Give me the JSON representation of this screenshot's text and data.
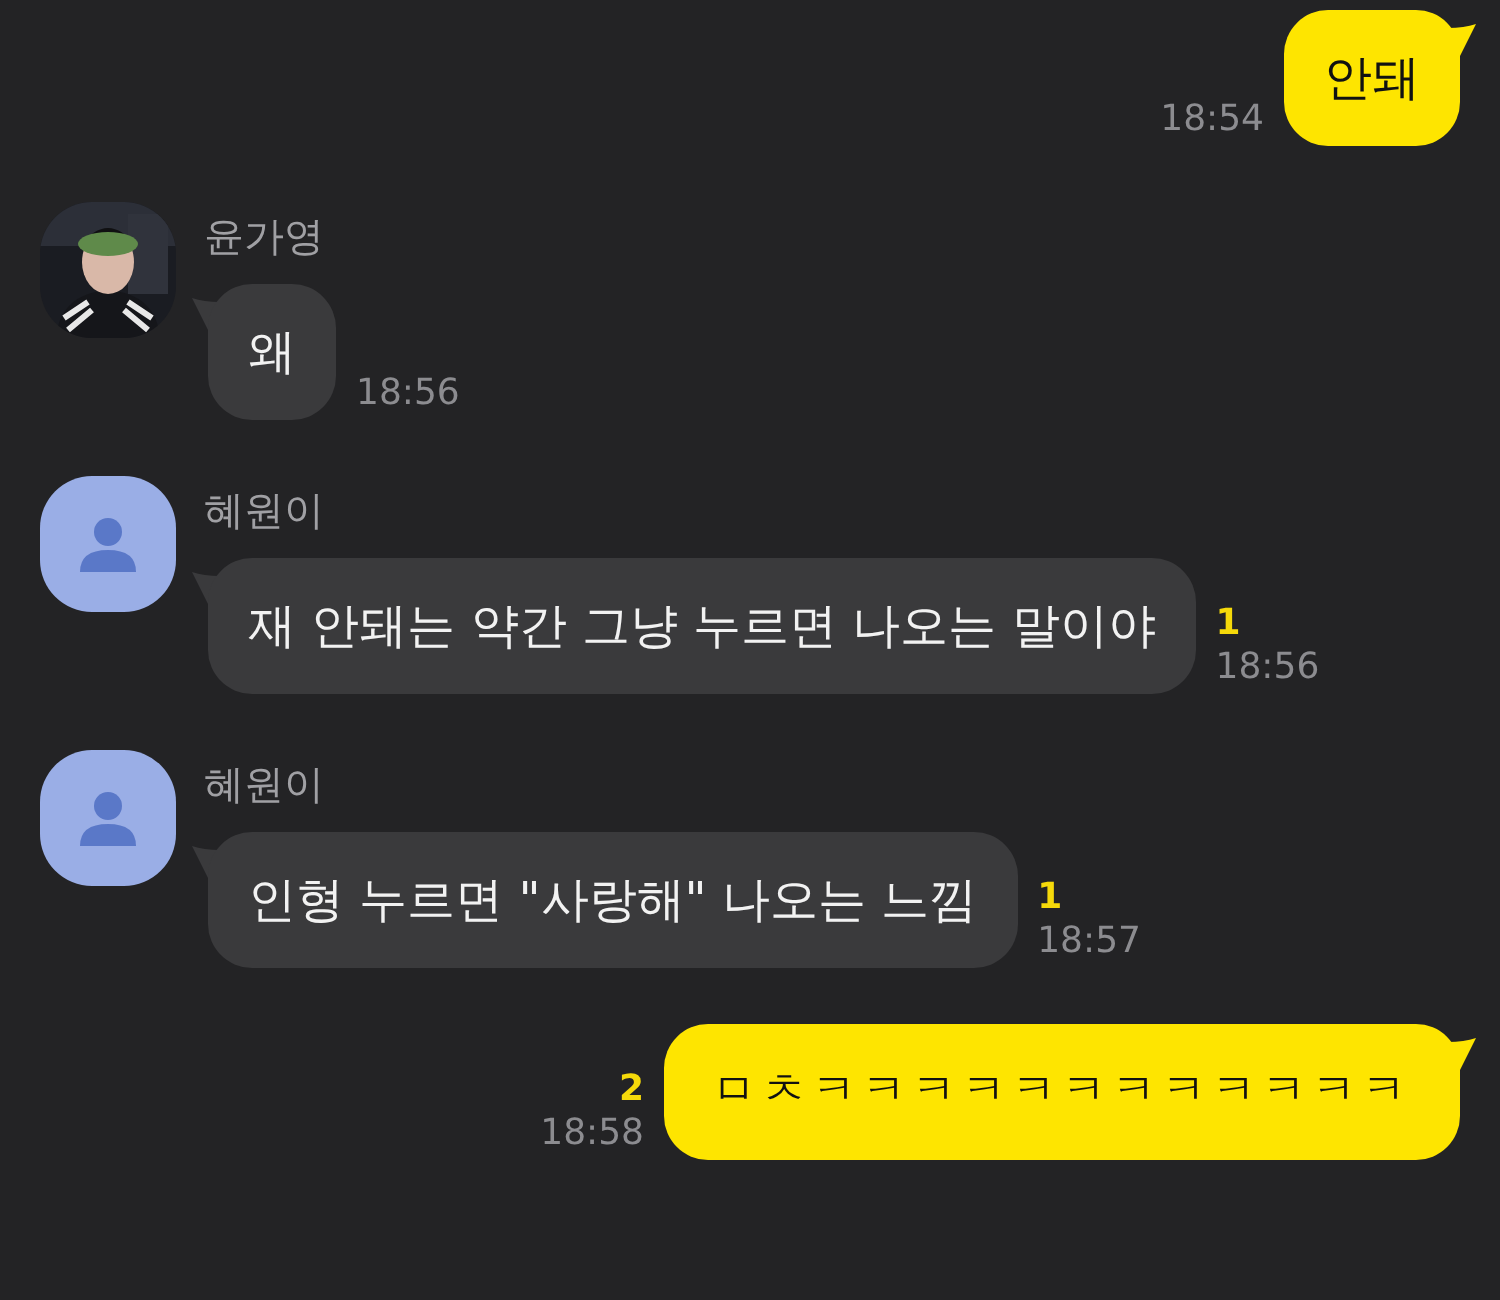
{
  "messages": [
    {
      "kind": "outgoing",
      "text": "안돼",
      "time": "18:54"
    },
    {
      "kind": "incoming",
      "sender": "윤가영",
      "text": "왜",
      "time": "18:56"
    },
    {
      "kind": "incoming",
      "sender": "혜원이",
      "avatar": {
        "kind": "default"
      },
      "text": "재 안돼는 약간 그냥 누르면 나오는 말이야",
      "unread": "1",
      "time": "18:56"
    },
    {
      "kind": "incoming",
      "sender": "혜원이",
      "avatar": {
        "kind": "default"
      },
      "text": "인형 누르면 \"사랑해\" 나오는 느낌",
      "unread": "1",
      "time": "18:57"
    },
    {
      "kind": "outgoing",
      "text": "ㅁㅊㅋㅋㅋㅋㅋㅋㅋㅋㅋㅋㅋㅋ",
      "unread": "2",
      "time": "18:58"
    }
  ]
}
